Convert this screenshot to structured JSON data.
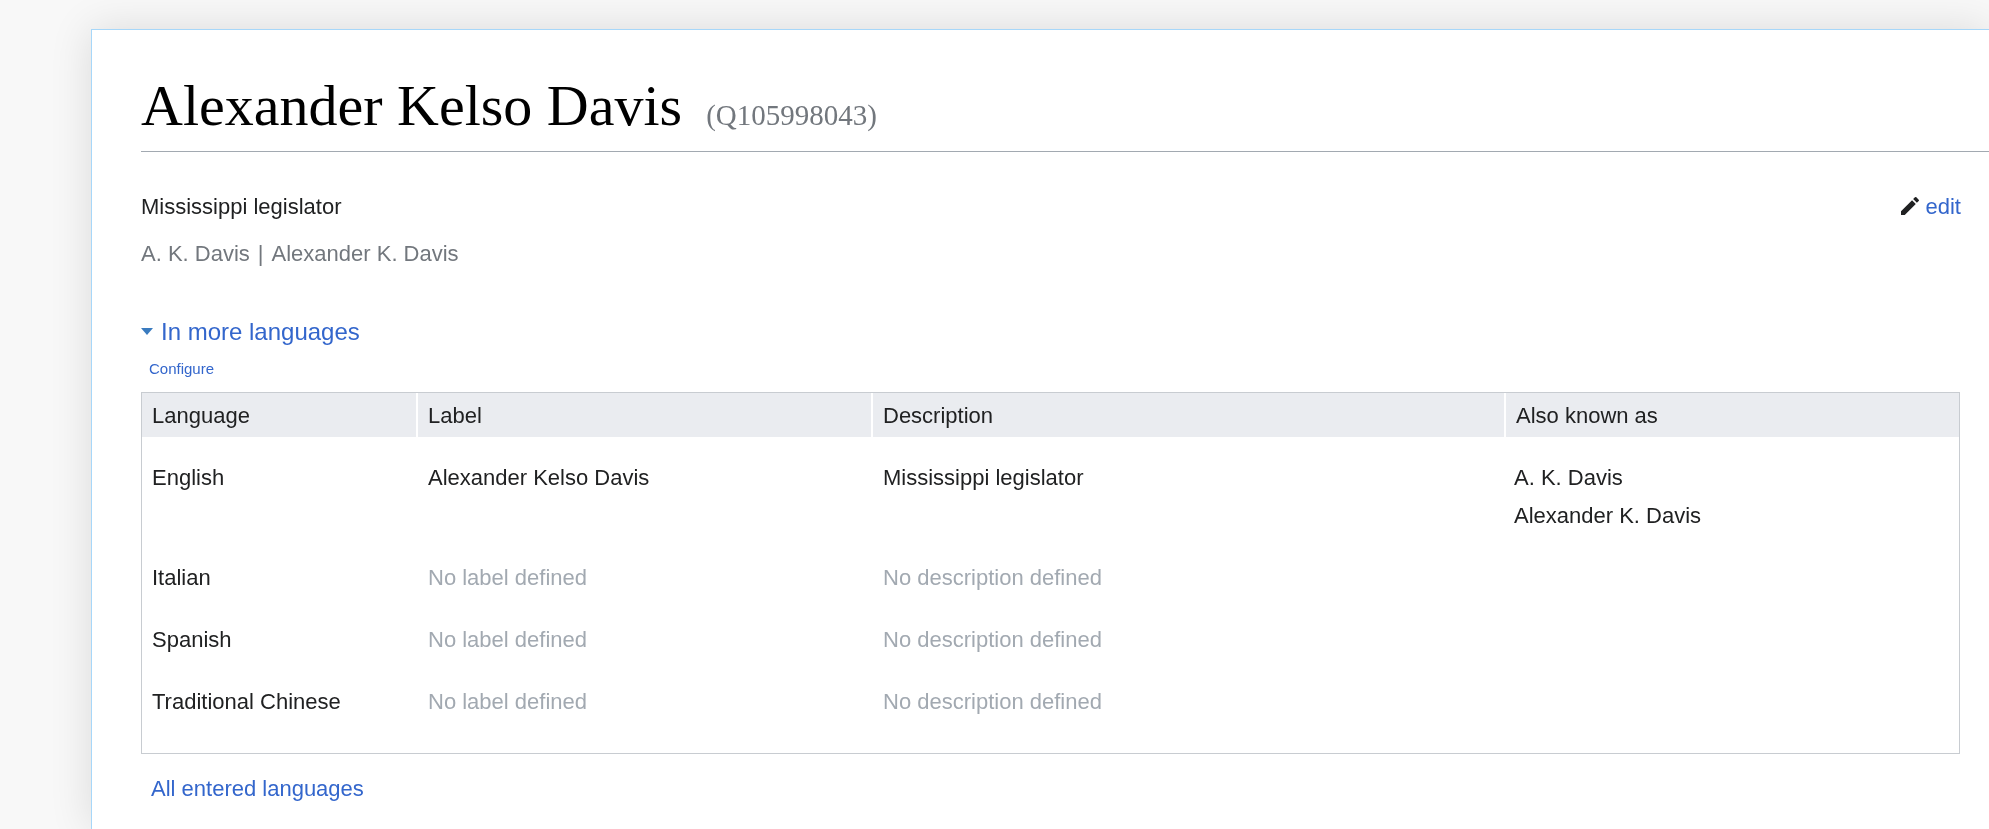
{
  "heading": {
    "title": "Alexander Kelso Davis",
    "id": "(Q105998043)"
  },
  "description": "Mississippi legislator",
  "aliases": [
    "A. K. Davis",
    "Alexander K. Davis"
  ],
  "alias_separator": "|",
  "edit_link": "edit",
  "languages_toggle": {
    "label": "In more languages",
    "expanded": true
  },
  "configure_link": "Configure",
  "table": {
    "columns": [
      "Language",
      "Label",
      "Description",
      "Also known as"
    ],
    "rows": [
      {
        "language": "English",
        "label": {
          "text": "Alexander Kelso Davis",
          "missing": false
        },
        "description": {
          "text": "Mississippi legislator",
          "missing": false
        },
        "aliases": [
          "A. K. Davis",
          "Alexander K. Davis"
        ]
      },
      {
        "language": "Italian",
        "label": {
          "text": "No label defined",
          "missing": true
        },
        "description": {
          "text": "No description defined",
          "missing": true
        }
      },
      {
        "language": "Spanish",
        "label": {
          "text": "No label defined",
          "missing": true
        },
        "description": {
          "text": "No description defined",
          "missing": true
        }
      },
      {
        "language": "Traditional Chinese",
        "label": {
          "text": "No label defined",
          "missing": true
        },
        "description": {
          "text": "No description defined",
          "missing": true
        }
      }
    ]
  },
  "all_languages_link": "All entered languages"
}
